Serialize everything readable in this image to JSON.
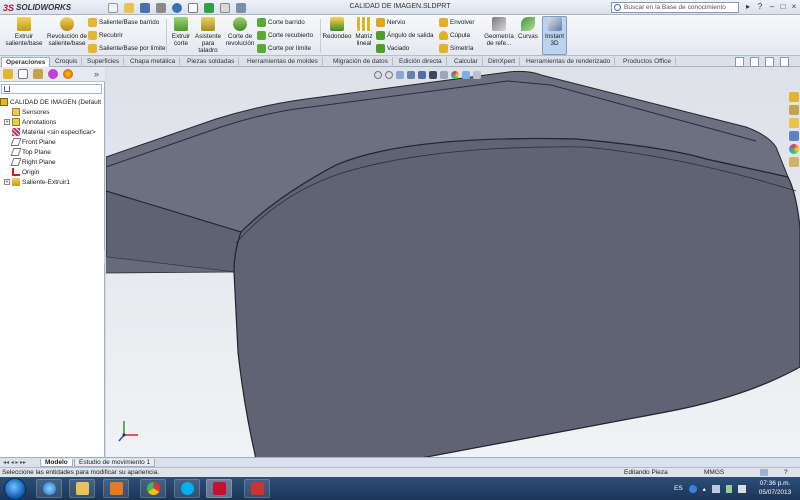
{
  "app": {
    "brand_ds": "3S",
    "brand_name": "SOLIDWORKS",
    "doc_title": "CALIDAD DE IMAGEN.SLDPRT"
  },
  "search": {
    "placeholder": "Buscar en la Base de conocimiento"
  },
  "ribbon": {
    "extrude_boss": "Extruir saliente/base",
    "revolve_boss": "Revolución de saliente/base",
    "swept_boss": "Saliente/Base barrido",
    "loft_boss": "Recubrir",
    "boundary_boss": "Saliente/Base por límite",
    "extrude_cut": "Extruir corte",
    "hole_wizard": "Asistente para taladro",
    "revolve_cut": "Corte de revolución",
    "swept_cut": "Corte barrido",
    "loft_cut": "Corte recubierto",
    "boundary_cut": "Corte por límite",
    "fillet": "Redondeo",
    "linear_pattern": "Matriz lineal",
    "rib": "Nervio",
    "draft": "Ángulo de salida",
    "shell": "Vaciado",
    "wrap": "Envolver",
    "dome": "Cúpula",
    "mirror": "Simetría",
    "reference_geometry": "Geometría de refe...",
    "curves": "Curvas",
    "instant3d": "Instant 3D"
  },
  "tabs": [
    "Operaciones",
    "Croquis",
    "Superficies",
    "Chapa metálica",
    "Piezas soldadas",
    "Herramientas de moldes",
    "Migración de datos",
    "Edición directa",
    "Calcular",
    "DimXpert",
    "Herramientas de renderizado",
    "Productos Office"
  ],
  "tree": {
    "root": "CALIDAD DE IMAGEN  (Default",
    "items": [
      "Sensores",
      "Annotations",
      "Material <sin especificar>",
      "Front Plane",
      "Top Plane",
      "Right Plane",
      "Origin",
      "Saliente-Extruir1"
    ]
  },
  "bottom_tabs": [
    "Modelo",
    "Estudio de movimiento 1"
  ],
  "status": {
    "message": "Seleccione las entidades para modificar su apariencia.",
    "mode": "Editando Pieza",
    "units": "MMGS"
  },
  "taskbar": {
    "lang": "ES",
    "time": "07:36 p.m.",
    "date": "05/07/2013"
  },
  "colors": {
    "model_face": "#626775",
    "model_top": "#6f7382",
    "edge": "#25282e",
    "accent": "#c8102e"
  }
}
